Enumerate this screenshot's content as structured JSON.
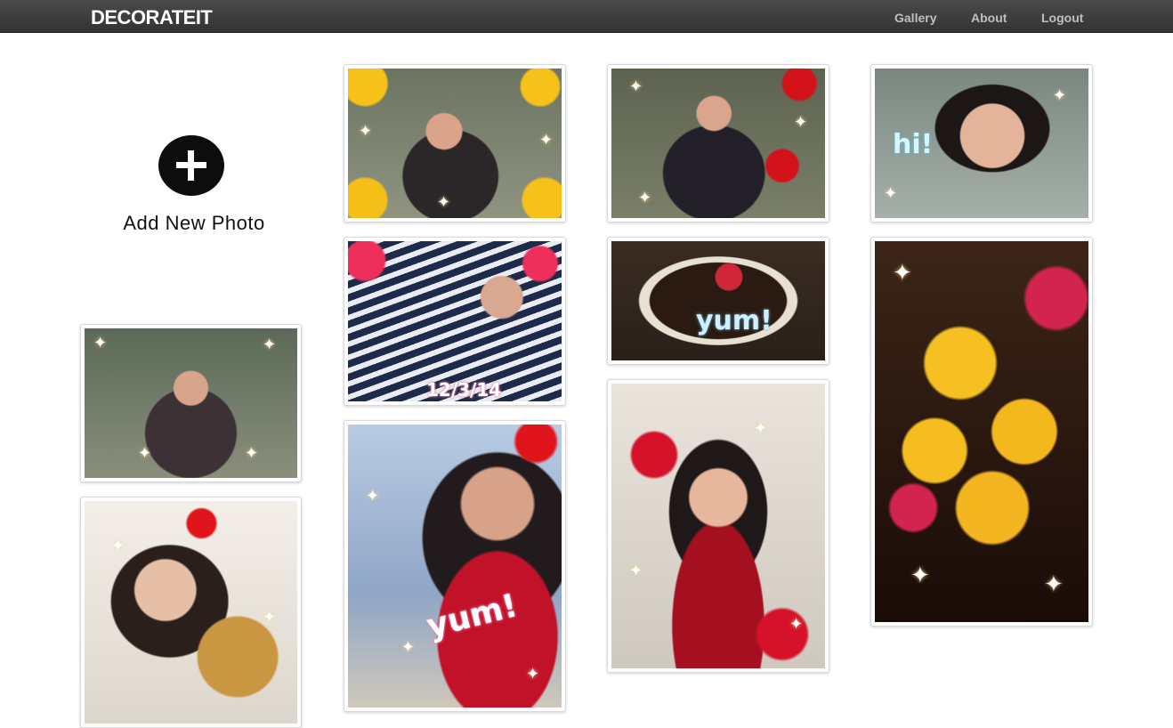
{
  "navbar": {
    "brand": "DECORATEIT",
    "links": [
      "Gallery",
      "About",
      "Logout"
    ]
  },
  "add_new": {
    "label": "Add New Photo",
    "icon": "plus-circle-icon"
  },
  "photos": [
    {
      "id": "photo-1",
      "overlay_text": ""
    },
    {
      "id": "photo-2",
      "overlay_text": ""
    },
    {
      "id": "photo-3",
      "overlay_text": "12/3/14"
    },
    {
      "id": "photo-4",
      "overlay_text": ""
    },
    {
      "id": "photo-5",
      "overlay_text": "yum!"
    },
    {
      "id": "photo-6",
      "overlay_text": "hi!"
    },
    {
      "id": "photo-7",
      "overlay_text": ""
    },
    {
      "id": "photo-8",
      "overlay_text": ""
    },
    {
      "id": "photo-9",
      "overlay_text": "yum!"
    },
    {
      "id": "photo-10",
      "overlay_text": ""
    }
  ],
  "colors": {
    "navbar": "#3d3d3d",
    "brand_text": "#ffffff",
    "nav_link": "#bfbfbf",
    "add_icon": "#0d0d0d"
  }
}
